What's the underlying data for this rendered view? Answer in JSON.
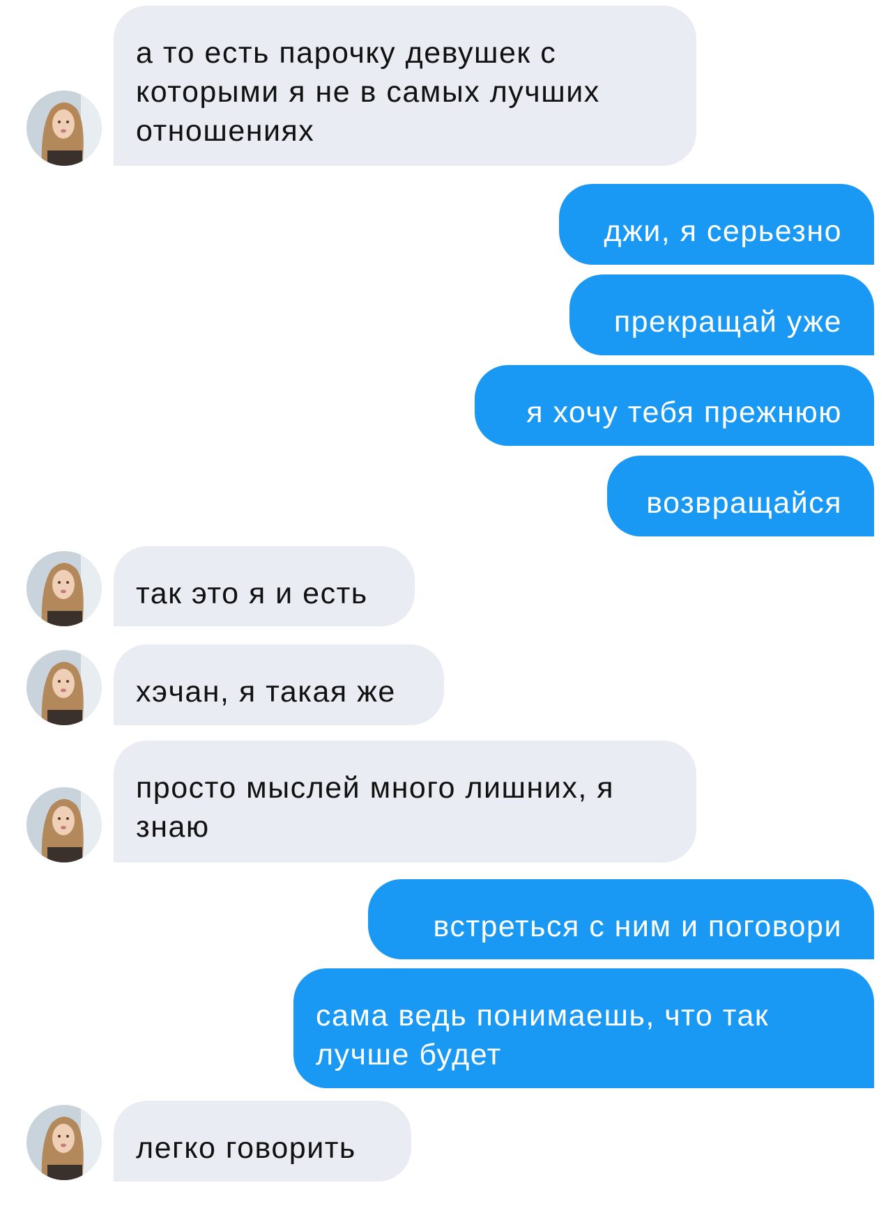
{
  "messages": [
    {
      "side": "incoming",
      "text": "а то есть парочку девушек с которыми я не в самых лучших отношениях"
    },
    {
      "side": "outgoing",
      "text": "джи, я серьезно"
    },
    {
      "side": "outgoing",
      "text": "прекращай уже"
    },
    {
      "side": "outgoing",
      "text": "я хочу тебя прежнюю"
    },
    {
      "side": "outgoing",
      "text": "возвращайся"
    },
    {
      "side": "incoming",
      "text": "так это я и есть"
    },
    {
      "side": "incoming",
      "text": "хэчан, я такая же"
    },
    {
      "side": "incoming",
      "text": "просто мыслей много лишних, я знаю"
    },
    {
      "side": "outgoing",
      "text": "встреться с ним и поговори"
    },
    {
      "side": "outgoing",
      "text": "сама ведь понимаешь, что так лучше будет"
    },
    {
      "side": "incoming",
      "text": "легко говорить"
    }
  ],
  "colors": {
    "incoming_bubble": "#e9ecf3",
    "outgoing_bubble": "#1a99f4",
    "incoming_text": "#111111",
    "outgoing_text": "#ffffff"
  },
  "avatar": {
    "icon": "user-avatar-photo"
  }
}
